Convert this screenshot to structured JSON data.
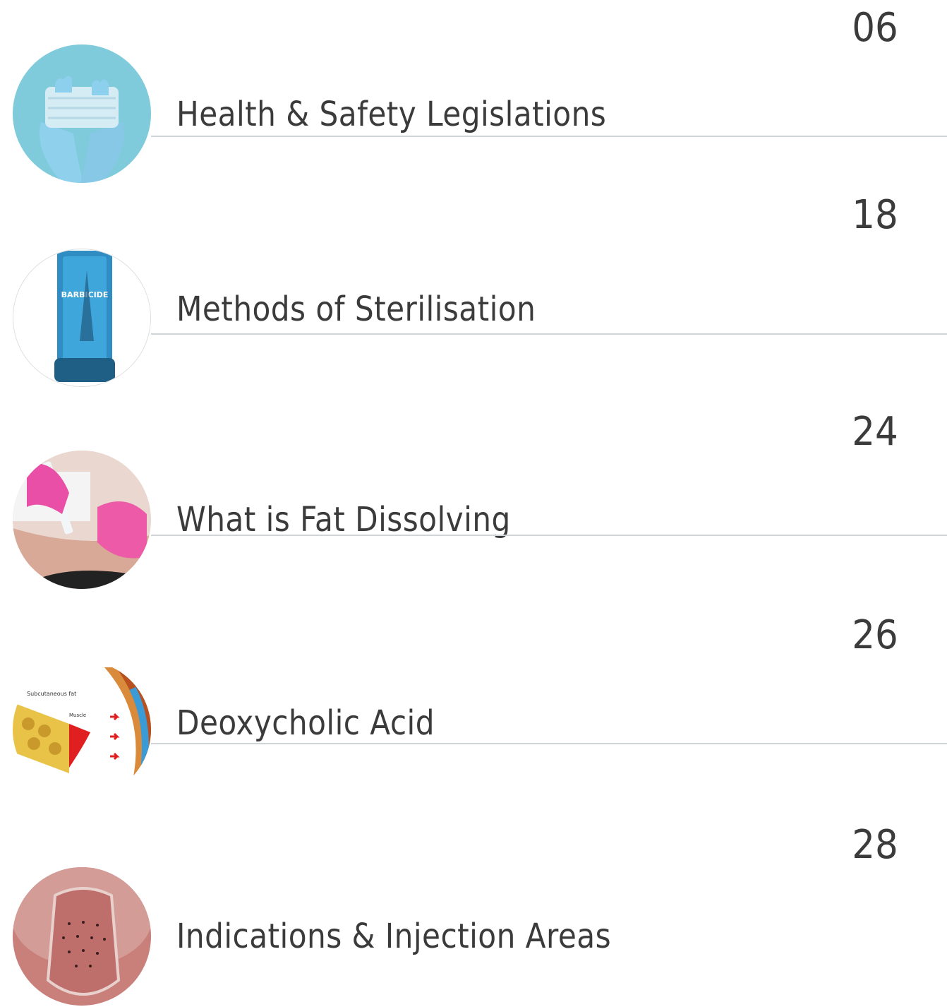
{
  "toc": {
    "items": [
      {
        "title": "Health & Safety Legislations",
        "page": "06",
        "image": "gloved-hands-holding-face-mask"
      },
      {
        "title": "Methods of Sterilisation",
        "page": "18",
        "image": "barbicide-disinfectant-jar"
      },
      {
        "title": "What is Fat Dissolving",
        "page": "24",
        "image": "syringe-injection-abdomen"
      },
      {
        "title": "Deoxycholic Acid",
        "page": "26",
        "image": "subcutaneous-fat-diagram"
      },
      {
        "title": "Indications & Injection Areas",
        "page": "28",
        "image": "chin-injection-grid"
      }
    ],
    "image_texts": {
      "jar_label": "BARBICIDE",
      "diagram_fat_label": "Subcutaneous fat",
      "diagram_muscle_label": "Muscle"
    }
  }
}
